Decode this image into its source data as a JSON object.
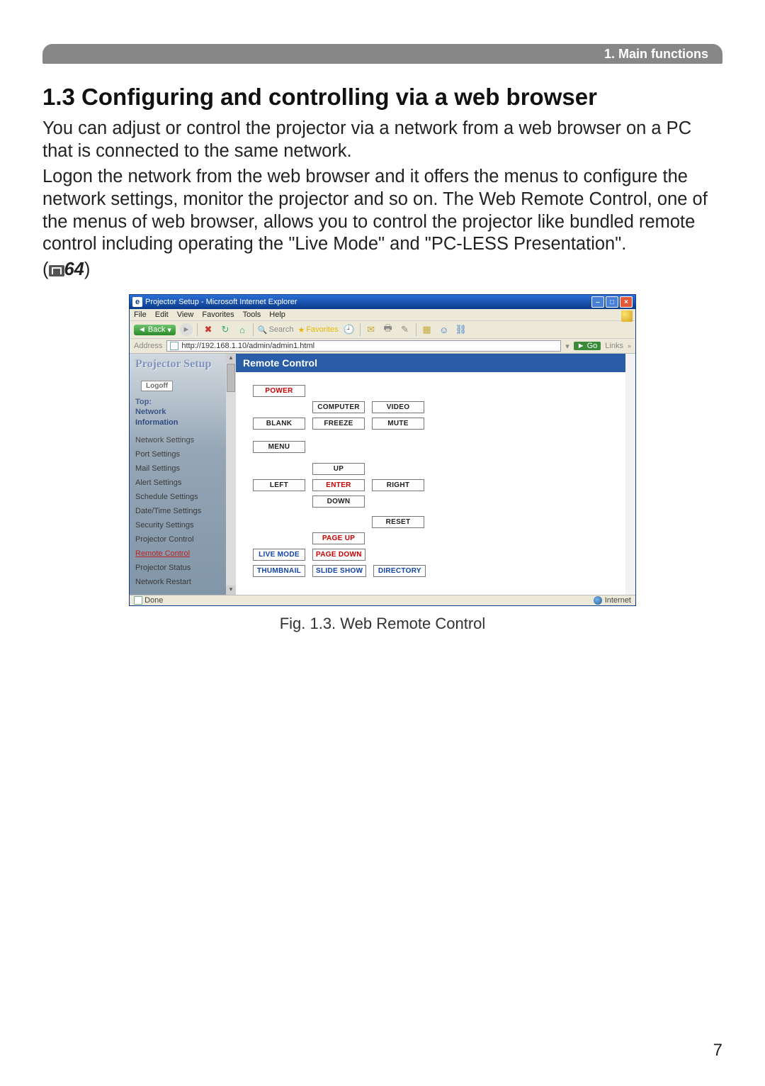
{
  "header": {
    "label": "1. Main functions"
  },
  "heading": "1.3 Configuring and controlling via a web browser",
  "para1": "You can adjust or control the projector via a network from a web browser on a PC that is connected to the same network.",
  "para2": "Logon the network from the web browser and it offers the menus to configure the network settings, monitor the projector and so on. The Web Remote Control, one of the menus of web browser, allows you to control the projector like bundled remote control including operating the \"Live Mode\" and \"PC-LESS Presentation\".",
  "ref_number": "64",
  "figure_caption": "Fig. 1.3. Web Remote Control",
  "page_number": "7",
  "ie": {
    "title": "Projector Setup - Microsoft Internet Explorer",
    "menus": [
      "File",
      "Edit",
      "View",
      "Favorites",
      "Tools",
      "Help"
    ],
    "back": "Back",
    "search": "Search",
    "favorites": "Favorites",
    "address_label": "Address",
    "address_value": "http://192.168.1.10/admin/admin1.html",
    "go": "Go",
    "links": "Links",
    "status_done": "Done",
    "status_zone": "Internet"
  },
  "sidebar": {
    "title": "Projector Setup",
    "logoff": "Logoff",
    "top_label": "Top:",
    "top_line1": "Network",
    "top_line2": "Information",
    "items": [
      {
        "label": "Network Settings"
      },
      {
        "label": "Port Settings"
      },
      {
        "label": "Mail Settings"
      },
      {
        "label": "Alert Settings"
      },
      {
        "label": "Schedule Settings"
      },
      {
        "label": "Date/Time Settings"
      },
      {
        "label": "Security Settings"
      },
      {
        "label": "Projector Control"
      },
      {
        "label": "Remote Control"
      },
      {
        "label": "Projector Status"
      },
      {
        "label": "Network Restart"
      }
    ],
    "active_index": 8
  },
  "panel": {
    "title": "Remote Control",
    "buttons": {
      "power": "POWER",
      "computer": "COMPUTER",
      "video": "VIDEO",
      "blank": "BLANK",
      "freeze": "FREEZE",
      "mute": "MUTE",
      "menu": "MENU",
      "up": "UP",
      "left": "LEFT",
      "enter": "ENTER",
      "right": "RIGHT",
      "down": "DOWN",
      "reset": "RESET",
      "pageup": "PAGE UP",
      "livemode": "LIVE MODE",
      "pagedown": "PAGE DOWN",
      "thumbnail": "THUMBNAIL",
      "slideshow": "SLIDE SHOW",
      "directory": "DIRECTORY"
    }
  }
}
